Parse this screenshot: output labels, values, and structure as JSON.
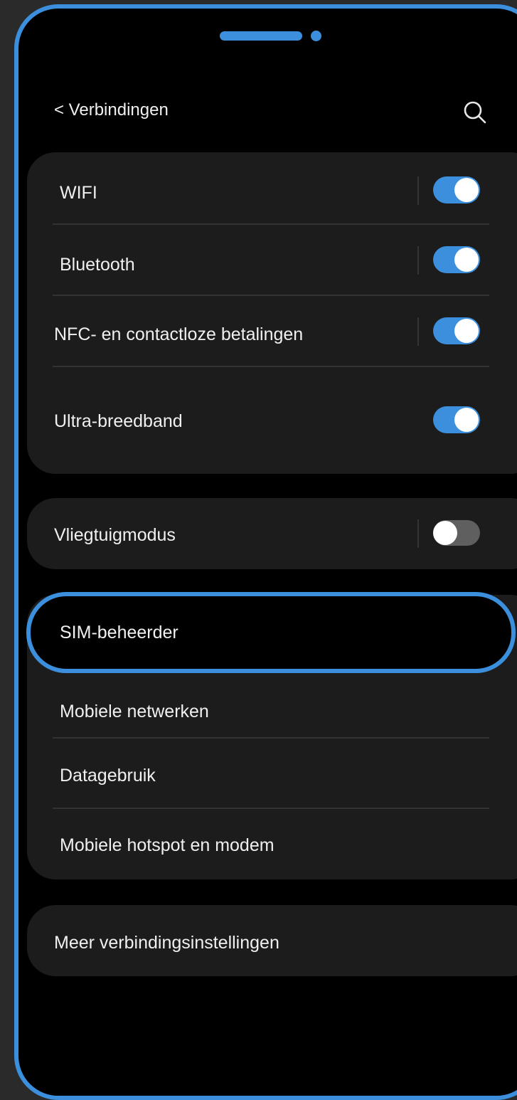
{
  "header": {
    "back_label": "< Verbindingen",
    "search_icon": "search-icon"
  },
  "group1": {
    "rows": [
      {
        "label": "WIFI",
        "toggle": true
      },
      {
        "label": "Bluetooth",
        "toggle": true
      },
      {
        "label": "NFC- en contactloze betalingen",
        "toggle": true
      },
      {
        "label": "Ultra-breedband",
        "toggle": true
      }
    ]
  },
  "group2": {
    "rows": [
      {
        "label": "Vliegtuigmodus",
        "toggle": false
      }
    ]
  },
  "group3": {
    "rows": [
      {
        "label": "SIM-beheerder"
      },
      {
        "label": "Mobiele netwerken"
      },
      {
        "label": "Datagebruik"
      },
      {
        "label": "Mobiele hotspot en modem"
      }
    ]
  },
  "group4": {
    "rows": [
      {
        "label": "Meer verbindingsinstellingen"
      }
    ]
  },
  "colors": {
    "accent": "#3b8fdc",
    "background": "#000000",
    "card": "#1c1c1c",
    "toggle_off": "#5f5f5f"
  }
}
